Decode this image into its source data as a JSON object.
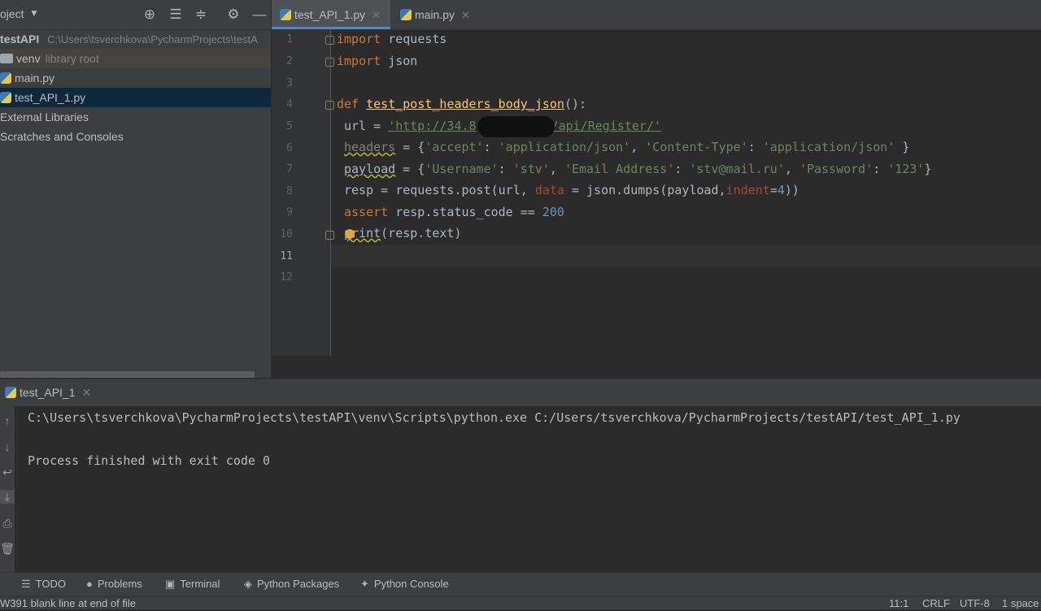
{
  "project": {
    "title": "oject",
    "toolbar_icons": [
      "crosshair-icon",
      "collapse-all-icon",
      "expand-all-icon",
      "gear-icon",
      "minimize-icon"
    ],
    "tree": {
      "root_name": "testAPI",
      "root_path": "C:\\Users\\tsverchkova\\PycharmProjects\\testA",
      "venv": "venv",
      "venv_hint": "library root",
      "main": "main.py",
      "test": "test_API_1.py",
      "ext_libs": "External Libraries",
      "scratches": "Scratches and Consoles"
    }
  },
  "tabs": {
    "active": "test_API_1.py",
    "second": "main.py"
  },
  "editor": {
    "line_numbers": [
      "1",
      "2",
      "3",
      "4",
      "5",
      "6",
      "7",
      "8",
      "9",
      "10",
      "11",
      "12"
    ],
    "current_line": "11",
    "code": {
      "l1_kw": "import",
      "l1_rest": " requests",
      "l2_kw": "import",
      "l2_rest": " json",
      "l4_kw": "def",
      "l4_fn": "test_post_headers_body_json",
      "l4_rest": "():",
      "l5_a": "url = ",
      "l5_str_a": "'http://34.8",
      "l5_str_b": "/api/Register/'",
      "l6_var": "headers",
      "l6_a": " = {",
      "l6_s1": "'accept'",
      "l6_b": ": ",
      "l6_s2": "'application/json'",
      "l6_c": ", ",
      "l6_s3": "'Content-Type'",
      "l6_d": ": ",
      "l6_s4": "'application/json'",
      "l6_e": " }",
      "l7_var": "payload",
      "l7_a": " = {",
      "l7_s1": "'Username'",
      "l7_b": ": ",
      "l7_s2": "'stv'",
      "l7_c": ", ",
      "l7_s3": "'Email Address'",
      "l7_d": ": ",
      "l7_s4": "'stv@mail.ru'",
      "l7_e": ", ",
      "l7_s5": "'Password'",
      "l7_f": ": ",
      "l7_s6": "'123'",
      "l7_g": "}",
      "l8_a": "resp = requests.post(url, ",
      "l8_param": "data",
      "l8_b": " = json.dumps(payload,",
      "l8_param2": "indent",
      "l8_c": "=",
      "l8_num": "4",
      "l8_d": "))",
      "l9_kw": "assert",
      "l9_rest": " resp.status_code == ",
      "l9_num": "200",
      "l10_a": "print",
      "l10_rest": "(resp.text)"
    }
  },
  "run": {
    "tab_label": "test_API_1",
    "side_icons": [
      "arrow-up-icon",
      "arrow-down-icon",
      "wrap-icon",
      "scroll-end-icon",
      "print-icon",
      "trash-icon"
    ],
    "command": "C:\\Users\\tsverchkova\\PycharmProjects\\testAPI\\venv\\Scripts\\python.exe C:/Users/tsverchkova/PycharmProjects/testAPI/test_API_1.py",
    "result": "Process finished with exit code 0"
  },
  "bottom_tools": {
    "todo": "TODO",
    "problems": "Problems",
    "terminal": "Terminal",
    "python_packages": "Python Packages",
    "python_console": "Python Console"
  },
  "status": {
    "message": "W391 blank line at end of file",
    "position": "11:1",
    "line_sep": "CRLF",
    "encoding": "UTF-8",
    "indent": "1 space"
  },
  "colors": {
    "keyword": "#cc7832",
    "function": "#ffc66d",
    "string": "#6a8759",
    "number": "#6897bb",
    "selection": "#0d293e"
  }
}
